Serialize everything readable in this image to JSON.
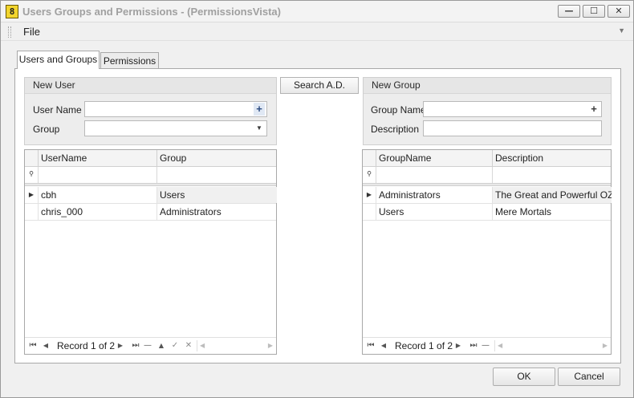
{
  "window": {
    "title": "Users Groups and Permissions - (PermissionsVista)",
    "icon_glyph": "8",
    "minimize_glyph": "—",
    "maximize_glyph": "☐",
    "close_glyph": "✕"
  },
  "menu": {
    "items": [
      "File"
    ],
    "overflow_glyph": "▼"
  },
  "tabs": [
    {
      "label": "Users and Groups",
      "active": true
    },
    {
      "label": "Permissions",
      "active": false
    }
  ],
  "new_user": {
    "caption": "New User",
    "username_label": "User Name",
    "username_value": "",
    "username_button_glyph": "+",
    "group_label": "Group",
    "group_value": "",
    "group_dropdown_glyph": "▼"
  },
  "search_ad_label": "Search A.D.",
  "new_group": {
    "caption": "New Group",
    "groupname_label": "Group Name",
    "groupname_value": "",
    "groupname_button_glyph": "+",
    "description_label": "Description",
    "description_value": ""
  },
  "users_grid": {
    "columns": [
      "UserName",
      "Group"
    ],
    "rows": [
      {
        "username": "cbh",
        "group": "Users",
        "current": true
      },
      {
        "username": "chris_000",
        "group": "Administrators",
        "current": false
      }
    ],
    "record_text": "Record 1 of 2"
  },
  "groups_grid": {
    "columns": [
      "GroupName",
      "Description"
    ],
    "rows": [
      {
        "groupname": "Administrators",
        "description": "The Great and Powerful OZ",
        "current": true
      },
      {
        "groupname": "Users",
        "description": "Mere Mortals",
        "current": false
      }
    ],
    "record_text": "Record 1 of 2"
  },
  "nav_glyphs": {
    "first": "⏮",
    "prev": "◀",
    "next": "▶",
    "last": "⏭",
    "delete": "—",
    "up": "▲",
    "save": "✓",
    "cancel": "✕",
    "scroll_left": "◀",
    "scroll_right": "▶",
    "row_indicator": "▶",
    "filter_icon": "⚲"
  },
  "buttons": {
    "ok": "OK",
    "cancel": "Cancel"
  }
}
